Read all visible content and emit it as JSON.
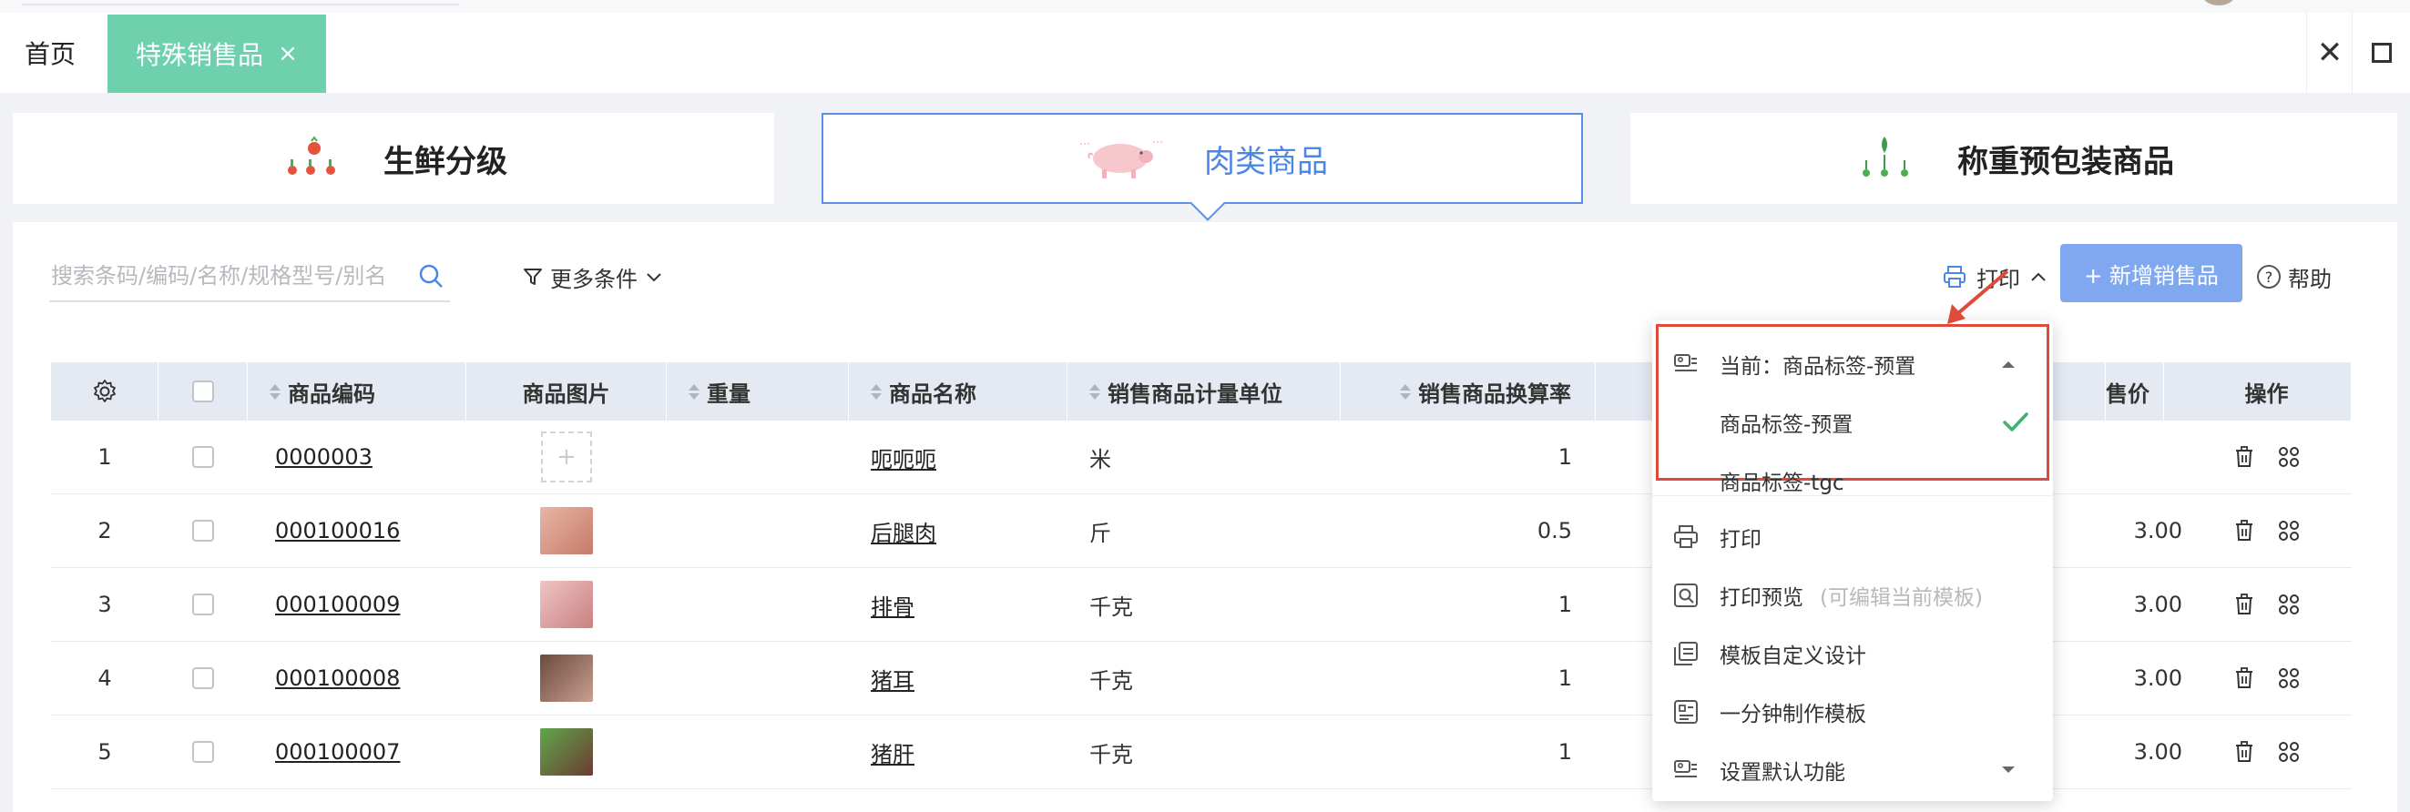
{
  "tabs": {
    "home_label": "首页",
    "active_label": "特殊销售品",
    "active_close": "×",
    "close_symbol": "✕"
  },
  "categories": [
    {
      "label": "生鲜分级",
      "icon": "vegetables-icon"
    },
    {
      "label": "肉类商品",
      "icon": "pig-icon"
    },
    {
      "label": "称重预包装商品",
      "icon": "greens-icon"
    }
  ],
  "toolbar": {
    "search_placeholder": "搜索条码/编码/名称/规格型号/别名",
    "more_filter_label": "更多条件",
    "print_label": "打印",
    "add_label": "+ 新增销售品",
    "help_label": "帮助",
    "help_symbol": "?"
  },
  "table": {
    "headers": {
      "code": "商品编码",
      "image": "商品图片",
      "weight": "重量",
      "name": "商品名称",
      "unit": "销售商品计量单位",
      "rate": "销售商品换算率",
      "price": "售价",
      "ops": "操作"
    },
    "rows": [
      {
        "index": "1",
        "code": "0000003",
        "image": "empty",
        "name": "呃呃呃",
        "unit": "米",
        "rate": "1",
        "price": ""
      },
      {
        "index": "2",
        "code": "000100016",
        "image": "ham",
        "name": "后腿肉",
        "unit": "斤",
        "rate": "0.5",
        "price": "3.00"
      },
      {
        "index": "3",
        "code": "000100009",
        "image": "ribs",
        "name": "排骨",
        "unit": "千克",
        "rate": "1",
        "price": "3.00"
      },
      {
        "index": "4",
        "code": "000100008",
        "image": "ears",
        "name": "猪耳",
        "unit": "千克",
        "rate": "1",
        "price": "3.00"
      },
      {
        "index": "5",
        "code": "000100007",
        "image": "liver",
        "name": "猪肝",
        "unit": "千克",
        "rate": "1",
        "price": "3.00"
      }
    ],
    "placeholder_symbol": "+"
  },
  "print_menu": {
    "current_label": "当前：商品标签-预置",
    "templates": [
      {
        "label": "商品标签-预置",
        "selected": true
      },
      {
        "label": "商品标签-tgc",
        "selected": false
      }
    ],
    "actions": [
      {
        "label": "打印",
        "hint": "",
        "icon": "printer-icon"
      },
      {
        "label": "打印预览",
        "hint": "(可编辑当前模板)",
        "icon": "preview-icon"
      },
      {
        "label": "模板自定义设计",
        "hint": "",
        "icon": "template-design-icon"
      },
      {
        "label": "一分钟制作模板",
        "hint": "",
        "icon": "quick-template-icon"
      },
      {
        "label": "设置默认功能",
        "hint": "",
        "icon": "default-setting-icon"
      }
    ]
  },
  "colors": {
    "accent": "#7fa8f0",
    "tab_active": "#6fd0ae",
    "highlight_border": "#e04a38",
    "check": "#3bb273"
  }
}
